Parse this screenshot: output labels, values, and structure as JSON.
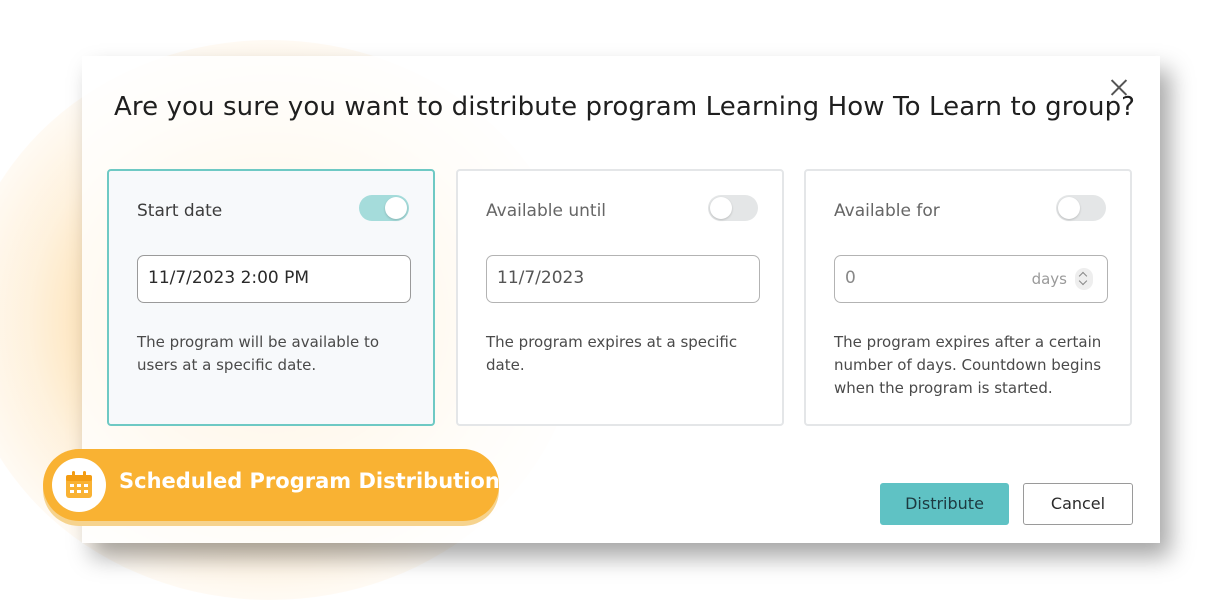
{
  "dialog": {
    "title": "Are you sure you want to distribute program Learning How To Learn to group?"
  },
  "cards": {
    "start": {
      "label": "Start date",
      "enabled": true,
      "value": "11/7/2023 2:00 PM",
      "description": "The program will be available to users at a specific date."
    },
    "until": {
      "label": "Available until",
      "enabled": false,
      "value": "11/7/2023",
      "description": "The program expires at a specific date."
    },
    "for": {
      "label": "Available for",
      "enabled": false,
      "value": "0",
      "unit": "days",
      "description": "The program expires after a certain number of days. Countdown begins when the program is started."
    }
  },
  "buttons": {
    "distribute": "Distribute",
    "cancel": "Cancel"
  },
  "badge": {
    "label": "Scheduled Program Distribution",
    "icon": "calendar-icon"
  },
  "colors": {
    "accent": "#5fc2c4",
    "toggle_on": "#a5dcdb",
    "badge": "#f9b233",
    "active_border": "#6ec9c4"
  }
}
